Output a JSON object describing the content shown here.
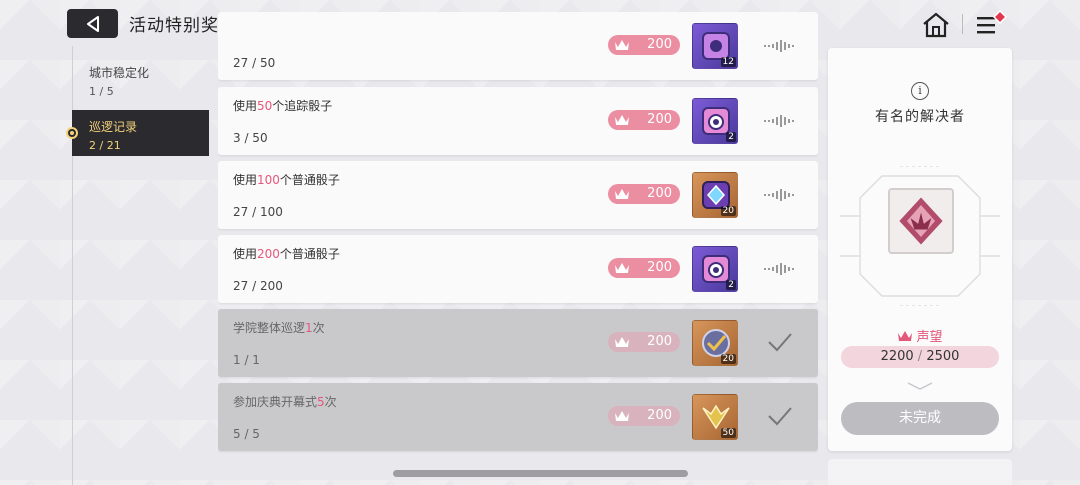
{
  "header": {
    "title": "活动特别奖励"
  },
  "sidebar": {
    "items": [
      {
        "label": "城市稳定化",
        "count": "1 / 5",
        "active": false
      },
      {
        "label": "巡逻记录",
        "count": "2 / 21",
        "active": true
      }
    ]
  },
  "tasks": [
    {
      "pre": "",
      "hl": "",
      "post": "",
      "progress": "27 / 50",
      "reward": "200",
      "item_qty": "12",
      "item_color": "purple",
      "status": "in_progress"
    },
    {
      "pre": "使用",
      "hl": "50",
      "post": "个追踪骰子",
      "progress": "3 / 50",
      "reward": "200",
      "item_qty": "2",
      "item_color": "purple",
      "status": "in_progress"
    },
    {
      "pre": "使用",
      "hl": "100",
      "post": "个普通骰子",
      "progress": "27 / 100",
      "reward": "200",
      "item_qty": "20",
      "item_color": "orange",
      "status": "in_progress"
    },
    {
      "pre": "使用",
      "hl": "200",
      "post": "个普通骰子",
      "progress": "27 / 200",
      "reward": "200",
      "item_qty": "2",
      "item_color": "purple",
      "status": "in_progress"
    },
    {
      "pre": "学院整体巡逻",
      "hl": "1",
      "post": "次",
      "progress": "1 / 1",
      "reward": "200",
      "item_qty": "20",
      "item_color": "orange",
      "status": "done"
    },
    {
      "pre": "参加庆典开幕式",
      "hl": "5",
      "post": "次",
      "progress": "5 / 5",
      "reward": "200",
      "item_qty": "50",
      "item_color": "orange",
      "status": "done"
    }
  ],
  "panel": {
    "info_glyph": "i",
    "title": "有名的解决者",
    "reputation_label": "声望",
    "reputation_current": "2200",
    "reputation_sep": " / ",
    "reputation_max": "2500",
    "button_label": "未完成"
  },
  "colors": {
    "accent_pink": "#e7577a",
    "pill_pink": "#ec8ea2",
    "active_gold": "#f4d27a",
    "dark": "#2b2b2f"
  }
}
